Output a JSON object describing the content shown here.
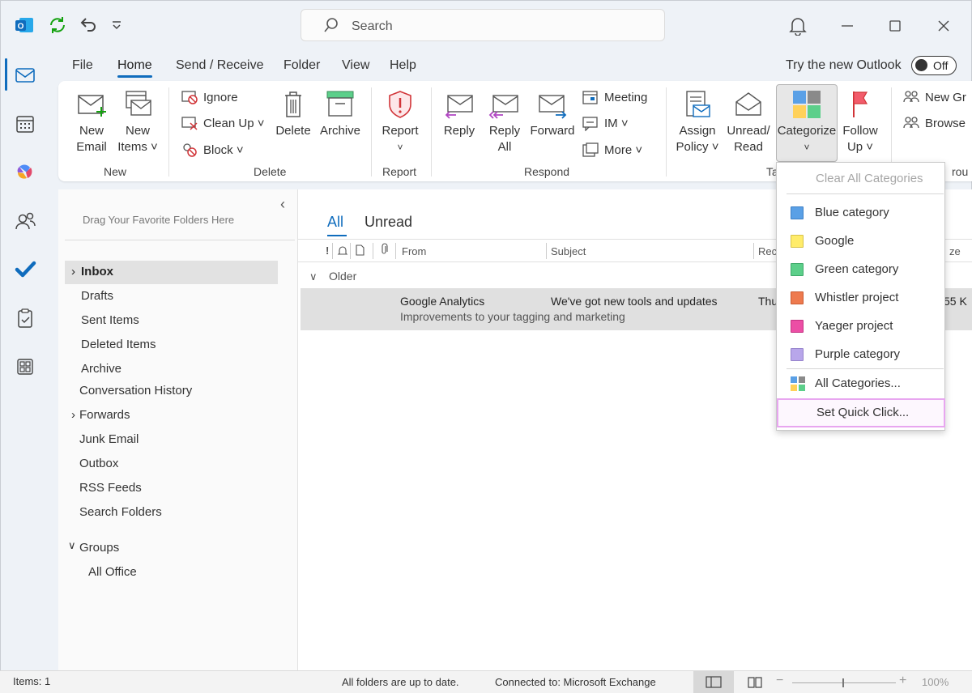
{
  "titlebar": {
    "search_placeholder": "Search"
  },
  "menu": {
    "tabs": [
      "File",
      "Home",
      "Send / Receive",
      "Folder",
      "View",
      "Help"
    ],
    "active": "Home",
    "try_new": "Try the new Outlook",
    "toggle": "Off"
  },
  "ribbon": {
    "new": {
      "email": [
        "New",
        "Email"
      ],
      "items": [
        "New",
        "Items ˅"
      ],
      "group": "New"
    },
    "delete": {
      "ignore": "Ignore",
      "cleanup": "Clean Up ˅",
      "block": "Block ˅",
      "delete": "Delete",
      "archive": "Archive",
      "group": "Delete"
    },
    "report": {
      "report": "Report",
      "chev": "˅",
      "group": "Report"
    },
    "respond": {
      "reply": "Reply",
      "reply_all": [
        "Reply",
        "All"
      ],
      "forward": "Forward",
      "meeting": "Meeting",
      "im": "IM ˅",
      "more": "More ˅",
      "group": "Respond"
    },
    "tags": {
      "assign": [
        "Assign",
        "Policy ˅"
      ],
      "unread": [
        "Unread/",
        "Read"
      ],
      "categorize": "Categorize",
      "chev": "˅",
      "follow": [
        "Follow",
        "Up ˅"
      ],
      "group": "Ta"
    },
    "groups": {
      "new_group": "New Gr",
      "browse": "Browse",
      "group": "rou"
    }
  },
  "folders": {
    "drag_hint": "Drag Your Favorite Folders Here",
    "items": [
      "Inbox",
      "Drafts",
      "Sent Items",
      "Deleted Items",
      "Archive",
      "Conversation History",
      "Forwards",
      "Junk Email",
      "Outbox",
      "RSS Feeds",
      "Search Folders"
    ],
    "groups_label": "Groups",
    "groups_items": [
      "All Office"
    ],
    "collapse": "‹"
  },
  "mail": {
    "filters": [
      "All",
      "Unread"
    ],
    "columns": {
      "from": "From",
      "subject": "Subject",
      "received": "Rec",
      "size": "ze"
    },
    "section": "Older",
    "message": {
      "from": "Google Analytics",
      "subject": "We've got new tools and updates",
      "preview": "Improvements to your tagging and marketing",
      "date": "Thu",
      "size": "55 K"
    }
  },
  "categories_menu": {
    "clear": "Clear All Categories",
    "items": [
      {
        "label": "Blue category",
        "color": "#5aa0e6"
      },
      {
        "label": "Google",
        "color": "#ffec6a"
      },
      {
        "label": "Green category",
        "color": "#5ccf8a"
      },
      {
        "label": "Whistler project",
        "color": "#ee7a4e"
      },
      {
        "label": "Yaeger project",
        "color": "#ec4ea5"
      },
      {
        "label": "Purple category",
        "color": "#b8a6ea"
      }
    ],
    "all": "All Categories...",
    "quick": "Set Quick Click..."
  },
  "status": {
    "items": "Items: 1",
    "folders": "All folders are up to date.",
    "connected": "Connected to: Microsoft Exchange",
    "zoom": "100%"
  },
  "colors": {
    "accent": "#0f6cbd",
    "highlight": "#e8c6f0"
  }
}
